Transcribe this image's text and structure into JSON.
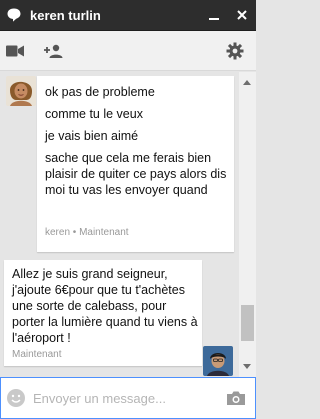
{
  "window": {
    "title": "keren turlin"
  },
  "toolbar": {
    "icons": [
      "video-call-icon",
      "add-person-icon",
      "settings-icon"
    ]
  },
  "conversation": {
    "incoming": {
      "lines": [
        "ok pas de probleme",
        "comme tu le veux",
        "je vais bien aimé",
        "sache que cela me ferais bien plaisir de quiter ce pays alors dis moi tu vas les envoyer quand"
      ],
      "meta": "keren • Maintenant"
    },
    "outgoing": {
      "text": "Allez je suis grand seigneur, j'ajoute 6€pour que tu t'achètes une sorte de calebass, pour porter la lumière quand tu viens à l'aéroport !",
      "meta": "Maintenant"
    }
  },
  "composer": {
    "placeholder": "Envoyer un message..."
  },
  "colors": {
    "titlebar": "#2d2d2d",
    "focus_border": "#4d90fe",
    "background": "#e5e5e5"
  }
}
